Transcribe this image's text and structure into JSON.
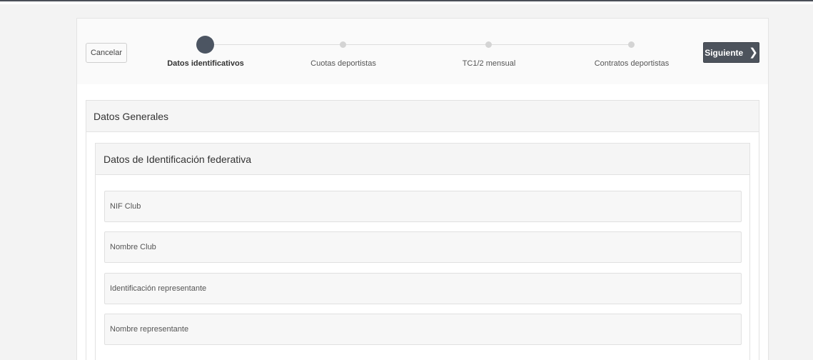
{
  "stepper": {
    "cancel_label": "Cancelar",
    "next_label": "Siguiente",
    "next_icon": "chevron-right-icon",
    "steps": [
      {
        "label": "Datos identificativos",
        "active": true
      },
      {
        "label": "Cuotas deportistas",
        "active": false
      },
      {
        "label": "TC1/2 mensual",
        "active": false
      },
      {
        "label": "Contratos deportistas",
        "active": false
      }
    ]
  },
  "general": {
    "title": "Datos Generales",
    "federative": {
      "title": "Datos de Identificación federativa",
      "fields": [
        {
          "placeholder": "NIF Club",
          "value": ""
        },
        {
          "placeholder": "Nombre Club",
          "value": ""
        },
        {
          "placeholder": "Identificación representante",
          "value": ""
        },
        {
          "placeholder": "Nombre representante",
          "value": ""
        }
      ]
    }
  },
  "colors": {
    "active_step": "#4c5562",
    "inactive_step": "#d4d4d4",
    "primary_button": "#4d535c"
  }
}
